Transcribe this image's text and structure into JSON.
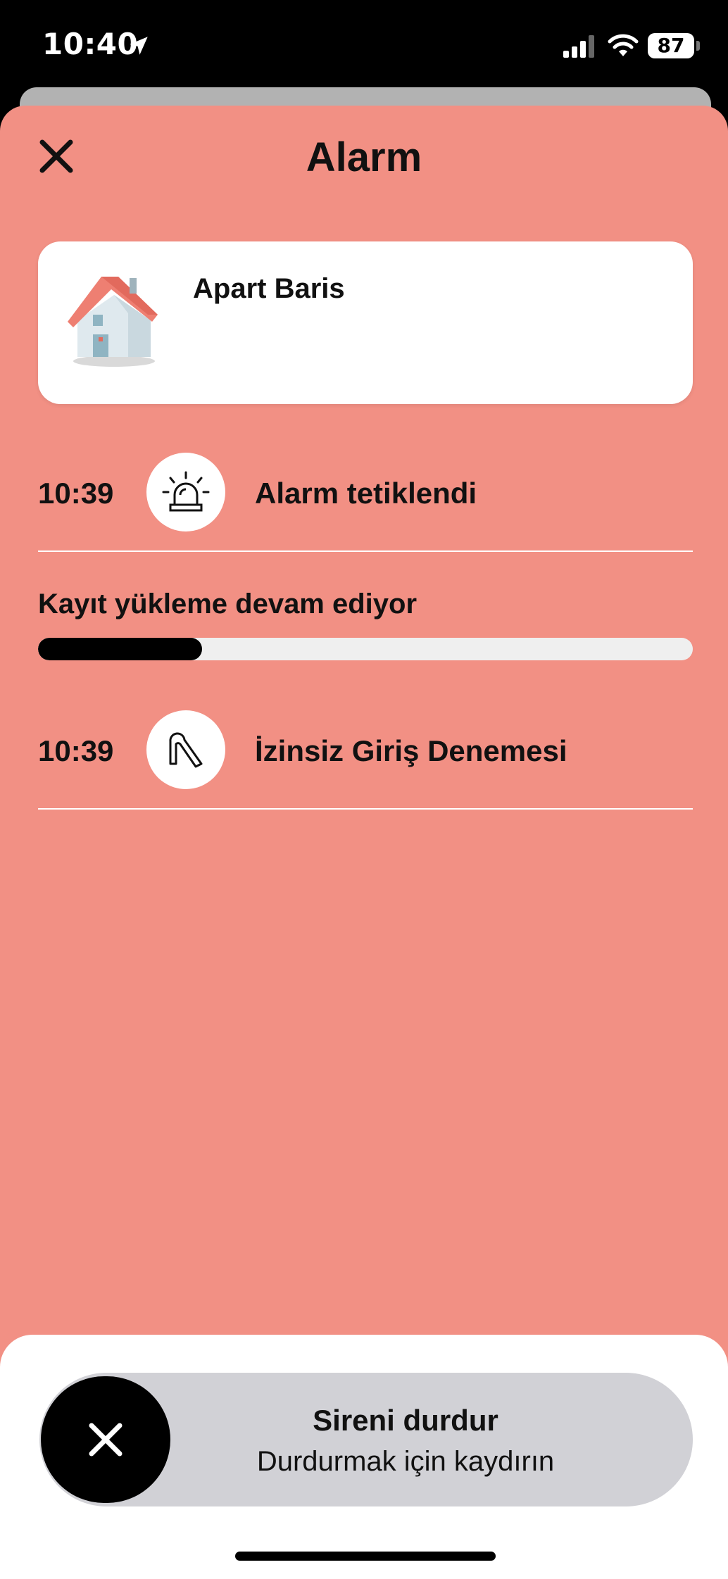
{
  "status_bar": {
    "time": "10:40",
    "battery": "87"
  },
  "header": {
    "title": "Alarm"
  },
  "property": {
    "name": "Apart Baris"
  },
  "events": [
    {
      "time": "10:39",
      "label": "Alarm tetiklendi",
      "icon": "siren-icon"
    },
    {
      "time": "10:39",
      "label": "İzinsiz Giriş Denemesi",
      "icon": "slide-icon"
    }
  ],
  "upload": {
    "label": "Kayıt yükleme devam ediyor",
    "progress": 0.25
  },
  "siren_slider": {
    "title": "Sireni durdur",
    "subtitle": "Durdurmak için kaydırın"
  },
  "colors": {
    "accent": "#f29084",
    "card": "#ffffff",
    "slider_track": "#d1d1d6"
  }
}
